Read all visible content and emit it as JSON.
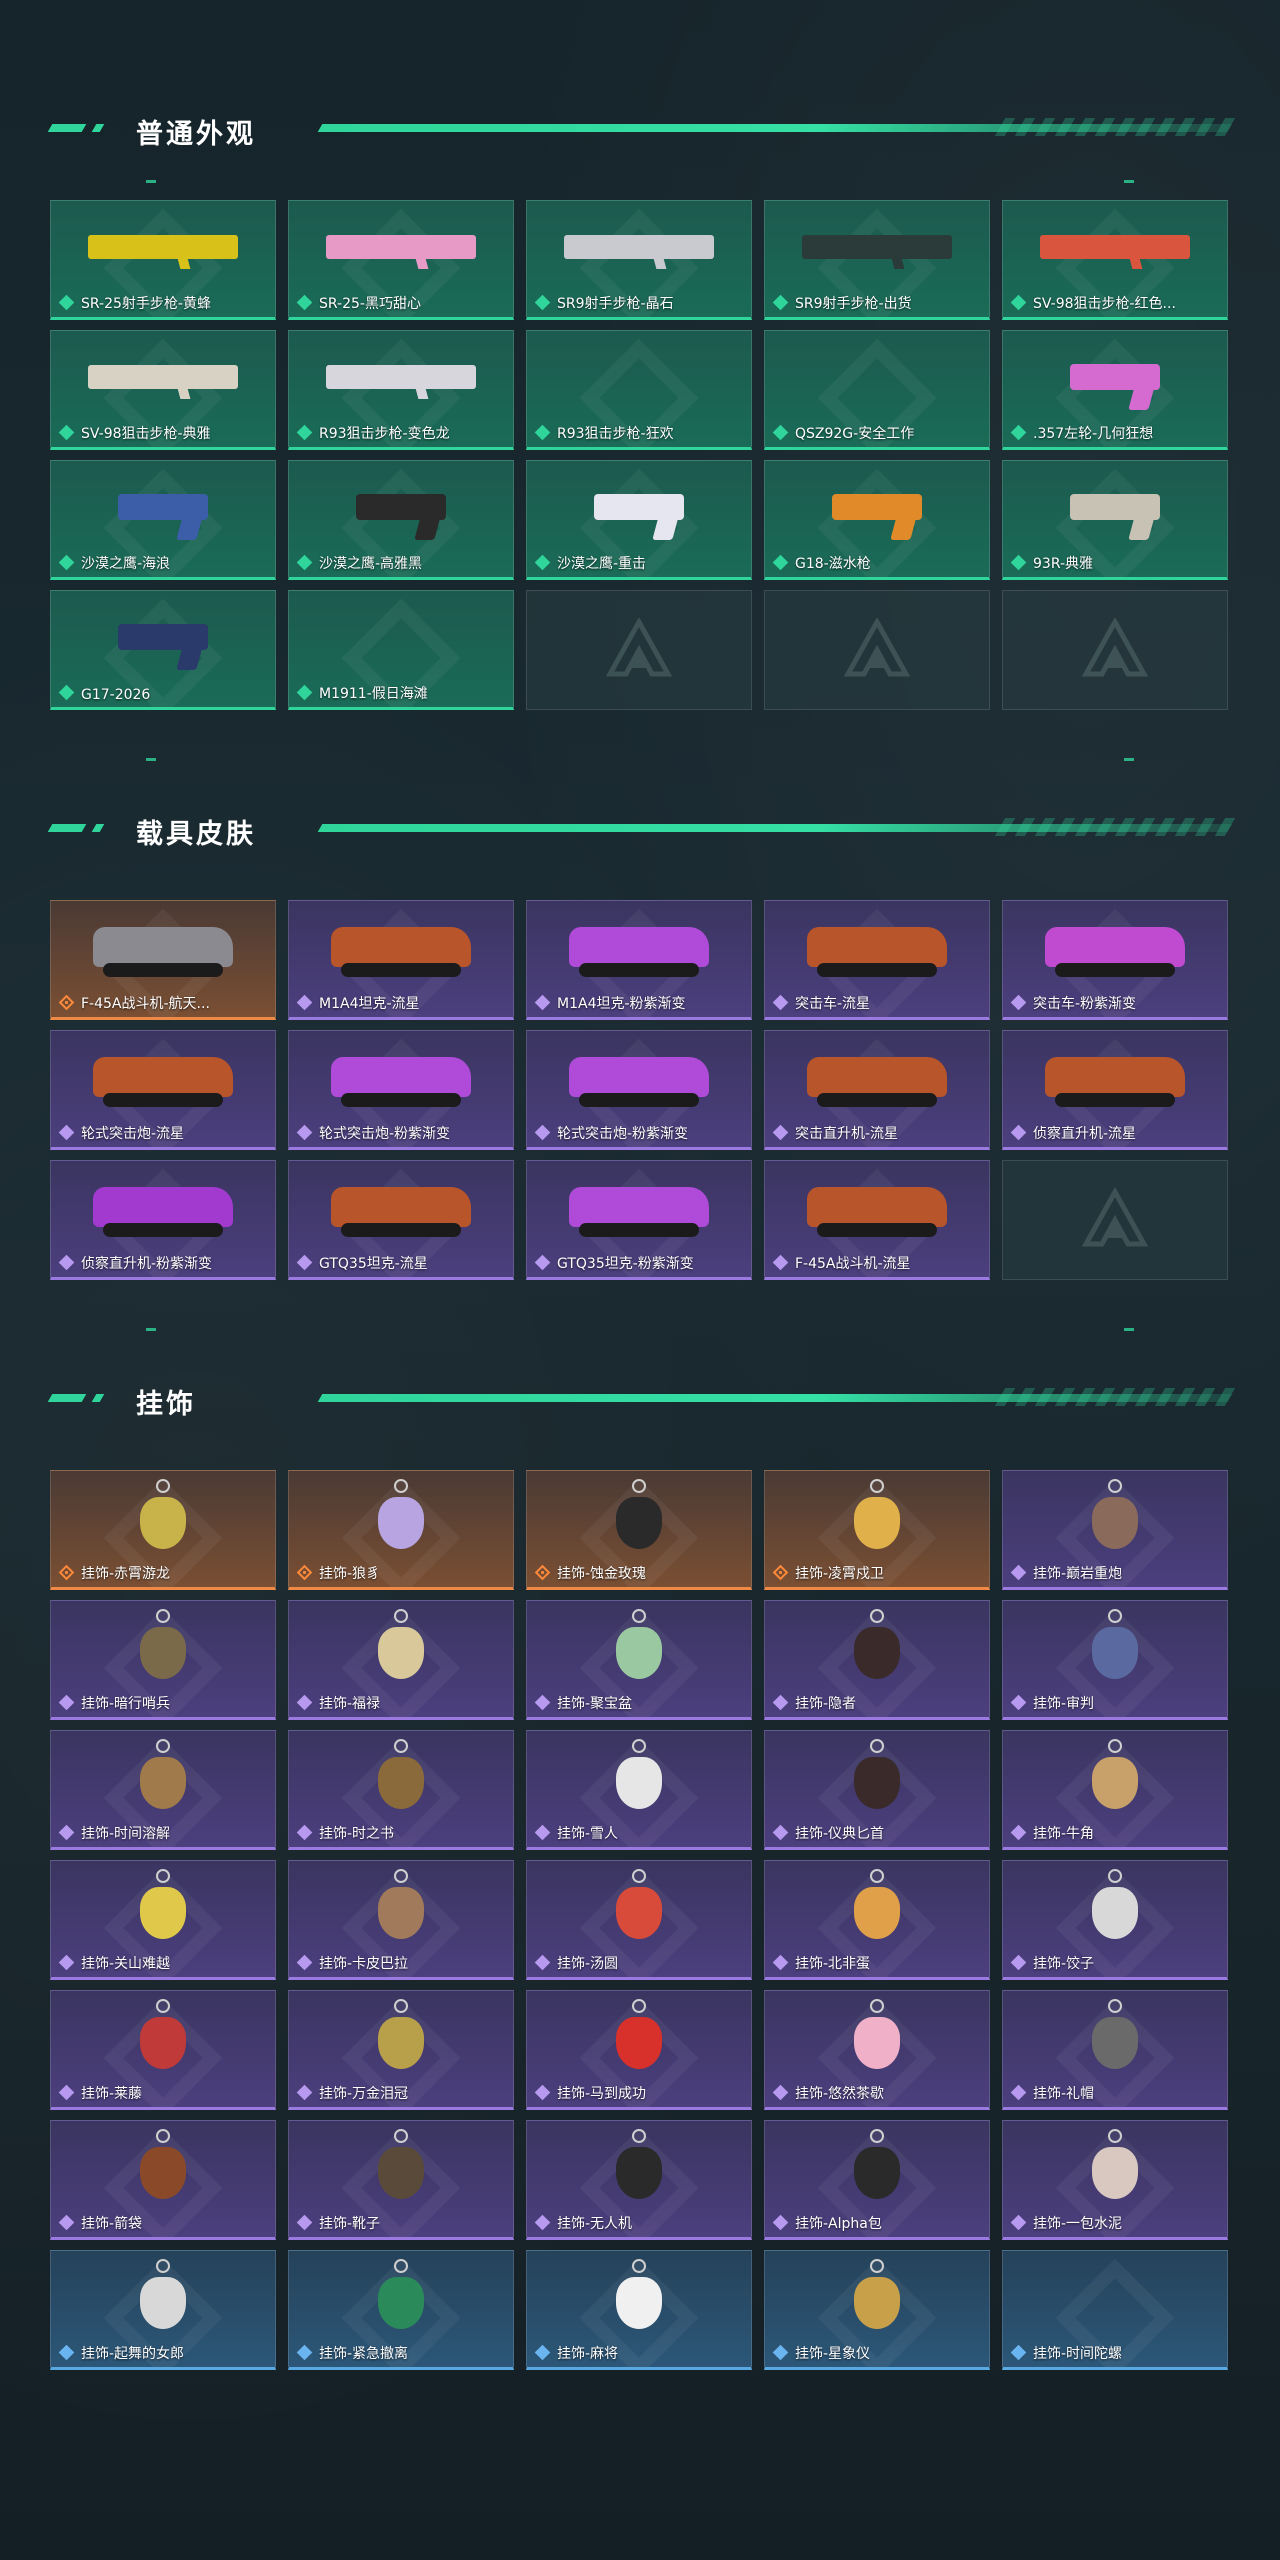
{
  "colors": {
    "accent_green": "#2fd59a",
    "rarity_green": "#1a6b57",
    "rarity_purple": "#4c3f7e",
    "rarity_orange": "#7a4f33",
    "rarity_blue": "#2c5778"
  },
  "sections": [
    {
      "title": "普通外观",
      "items": [
        {
          "label": "SR-25射手步枪-黄蜂",
          "rarity": "green",
          "icon": "rifle-icon",
          "tint": "#d8c21a"
        },
        {
          "label": "SR-25-黑巧甜心",
          "rarity": "green",
          "icon": "rifle-icon",
          "tint": "#e79ac6"
        },
        {
          "label": "SR9射手步枪-晶石",
          "rarity": "green",
          "icon": "rifle-icon",
          "tint": "#c9c9d0"
        },
        {
          "label": "SR9射手步枪-出货",
          "rarity": "green",
          "icon": "rifle-icon",
          "tint": "#2b3b3a"
        },
        {
          "label": "SV-98狙击步枪-红色...",
          "rarity": "green",
          "icon": "rifle-icon",
          "tint": "#d9553e"
        },
        {
          "label": "SV-98狙击步枪-典雅",
          "rarity": "green",
          "icon": "rifle-icon",
          "tint": "#d8d2c4"
        },
        {
          "label": "R93狙击步枪-变色龙",
          "rarity": "green",
          "icon": "rifle-icon",
          "tint": "#d6d6dc"
        },
        {
          "label": "R93狙击步枪-狂欢",
          "rarity": "green",
          "icon": "rifle-icon",
          "tint": ""
        },
        {
          "label": "QSZ92G-安全工作",
          "rarity": "green",
          "icon": "pistol-icon",
          "tint": ""
        },
        {
          "label": ".357左轮-几何狂想",
          "rarity": "green",
          "icon": "revolver-icon",
          "tint": "#d56bd0"
        },
        {
          "label": "沙漠之鹰-海浪",
          "rarity": "green",
          "icon": "pistol-icon",
          "tint": "#3c5ea8"
        },
        {
          "label": "沙漠之鹰-高雅黑",
          "rarity": "green",
          "icon": "pistol-icon",
          "tint": "#2a2a2a"
        },
        {
          "label": "沙漠之鹰-重击",
          "rarity": "green",
          "icon": "pistol-icon",
          "tint": "#e6e6f0"
        },
        {
          "label": "G18-滋水枪",
          "rarity": "green",
          "icon": "pistol-icon",
          "tint": "#e08a2a"
        },
        {
          "label": "93R-典雅",
          "rarity": "green",
          "icon": "pistol-icon",
          "tint": "#c8c2b4"
        },
        {
          "label": "G17-2026",
          "rarity": "green",
          "icon": "pistol-icon",
          "tint": "#2a3a6a"
        },
        {
          "label": "M1911-假日海滩",
          "rarity": "green",
          "icon": "pistol-icon",
          "tint": ""
        },
        {
          "label": "",
          "rarity": "empty",
          "icon": "logo-icon",
          "tint": ""
        },
        {
          "label": "",
          "rarity": "empty",
          "icon": "logo-icon",
          "tint": ""
        },
        {
          "label": "",
          "rarity": "empty",
          "icon": "logo-icon",
          "tint": ""
        }
      ]
    },
    {
      "title": "载具皮肤",
      "items": [
        {
          "label": "F-45A战斗机-航天...",
          "rarity": "orange",
          "icon": "jet-icon",
          "tint": "#8a8a90"
        },
        {
          "label": "M1A4坦克-流星",
          "rarity": "purple",
          "icon": "tank-icon",
          "tint": "#b8552a"
        },
        {
          "label": "M1A4坦克-粉紫渐变",
          "rarity": "purple",
          "icon": "tank-icon",
          "tint": "#b04ad8"
        },
        {
          "label": "突击车-流星",
          "rarity": "purple",
          "icon": "truck-icon",
          "tint": "#b8552a"
        },
        {
          "label": "突击车-粉紫渐变",
          "rarity": "purple",
          "icon": "truck-icon",
          "tint": "#c04ad0"
        },
        {
          "label": "轮式突击炮-流星",
          "rarity": "purple",
          "icon": "armored-car-icon",
          "tint": "#b8552a"
        },
        {
          "label": "轮式突击炮-粉紫渐变",
          "rarity": "purple",
          "icon": "armored-car-icon",
          "tint": "#b04ad8"
        },
        {
          "label": "轮式突击炮-粉紫渐变",
          "rarity": "purple",
          "icon": "armored-car-icon",
          "tint": "#b04ad8"
        },
        {
          "label": "突击直升机-流星",
          "rarity": "purple",
          "icon": "helicopter-icon",
          "tint": "#b8552a"
        },
        {
          "label": "侦察直升机-流星",
          "rarity": "purple",
          "icon": "helicopter-icon",
          "tint": "#b8552a"
        },
        {
          "label": "侦察直升机-粉紫渐变",
          "rarity": "purple",
          "icon": "helicopter-icon",
          "tint": "#a23ad0"
        },
        {
          "label": "GTQ35坦克-流星",
          "rarity": "purple",
          "icon": "tank-icon",
          "tint": "#b8552a"
        },
        {
          "label": "GTQ35坦克-粉紫渐变",
          "rarity": "purple",
          "icon": "tank-icon",
          "tint": "#b04ad8"
        },
        {
          "label": "F-45A战斗机-流星",
          "rarity": "purple",
          "icon": "jet-icon",
          "tint": "#b8552a"
        },
        {
          "label": "",
          "rarity": "empty",
          "icon": "logo-icon",
          "tint": ""
        }
      ]
    },
    {
      "title": "挂饰",
      "items": [
        {
          "label": "挂饰-赤霄游龙",
          "rarity": "orange",
          "icon": "charm-icon",
          "tint": "#c8b24a"
        },
        {
          "label": "挂饰-狼豸",
          "rarity": "orange",
          "icon": "charm-icon",
          "tint": "#b7a4e0"
        },
        {
          "label": "挂饰-蚀金玫瑰",
          "rarity": "orange",
          "icon": "charm-icon",
          "tint": "#2a2a2a"
        },
        {
          "label": "挂饰-凌霄戍卫",
          "rarity": "orange",
          "icon": "charm-icon",
          "tint": "#e0b04a"
        },
        {
          "label": "挂饰-巅岩重炮",
          "rarity": "purple",
          "icon": "charm-icon",
          "tint": "#8a6a5a"
        },
        {
          "label": "挂饰-暗行哨兵",
          "rarity": "purple",
          "icon": "charm-icon",
          "tint": "#7a6a4a"
        },
        {
          "label": "挂饰-福禄",
          "rarity": "purple",
          "icon": "charm-icon",
          "tint": "#d8c89a"
        },
        {
          "label": "挂饰-聚宝盆",
          "rarity": "purple",
          "icon": "charm-icon",
          "tint": "#9ac8a0"
        },
        {
          "label": "挂饰-隐者",
          "rarity": "purple",
          "icon": "charm-icon",
          "tint": "#3a2a2a"
        },
        {
          "label": "挂饰-审判",
          "rarity": "purple",
          "icon": "charm-icon",
          "tint": "#5a6aa0"
        },
        {
          "label": "挂饰-时间溶解",
          "rarity": "purple",
          "icon": "charm-icon",
          "tint": "#a07a4a"
        },
        {
          "label": "挂饰-时之书",
          "rarity": "purple",
          "icon": "charm-icon",
          "tint": "#8a6a3a"
        },
        {
          "label": "挂饰-雪人",
          "rarity": "purple",
          "icon": "charm-icon",
          "tint": "#e6e6e6"
        },
        {
          "label": "挂饰-仪典匕首",
          "rarity": "purple",
          "icon": "charm-icon",
          "tint": "#3a2a2a"
        },
        {
          "label": "挂饰-牛角",
          "rarity": "purple",
          "icon": "charm-icon",
          "tint": "#c8a06a"
        },
        {
          "label": "挂饰-关山难越",
          "rarity": "purple",
          "icon": "charm-icon",
          "tint": "#e0c84a"
        },
        {
          "label": "挂饰-卡皮巴拉",
          "rarity": "purple",
          "icon": "charm-icon",
          "tint": "#a07a5a"
        },
        {
          "label": "挂饰-汤圆",
          "rarity": "purple",
          "icon": "charm-icon",
          "tint": "#d84a3a"
        },
        {
          "label": "挂饰-北非蛋",
          "rarity": "purple",
          "icon": "charm-icon",
          "tint": "#e0a04a"
        },
        {
          "label": "挂饰-饺子",
          "rarity": "purple",
          "icon": "charm-icon",
          "tint": "#d8d8d8"
        },
        {
          "label": "挂饰-莱藤",
          "rarity": "purple",
          "icon": "charm-icon",
          "tint": "#c03a3a"
        },
        {
          "label": "挂饰-万金泪冠",
          "rarity": "purple",
          "icon": "charm-icon",
          "tint": "#b8a04a"
        },
        {
          "label": "挂饰-马到成功",
          "rarity": "purple",
          "icon": "charm-icon",
          "tint": "#d8302a"
        },
        {
          "label": "挂饰-悠然茶歇",
          "rarity": "purple",
          "icon": "charm-icon",
          "tint": "#f0b0c8"
        },
        {
          "label": "挂饰-礼帽",
          "rarity": "purple",
          "icon": "charm-icon",
          "tint": "#6a6a6a"
        },
        {
          "label": "挂饰-箭袋",
          "rarity": "purple",
          "icon": "charm-icon",
          "tint": "#8a4a2a"
        },
        {
          "label": "挂饰-靴子",
          "rarity": "purple",
          "icon": "charm-icon",
          "tint": "#5a4a3a"
        },
        {
          "label": "挂饰-无人机",
          "rarity": "purple",
          "icon": "charm-icon",
          "tint": "#2a2a2a"
        },
        {
          "label": "挂饰-Alpha包",
          "rarity": "purple",
          "icon": "charm-icon",
          "tint": "#2a2a2a"
        },
        {
          "label": "挂饰-一包水泥",
          "rarity": "purple",
          "icon": "charm-icon",
          "tint": "#d8c8c0"
        },
        {
          "label": "挂饰-起舞的女郎",
          "rarity": "blue",
          "icon": "charm-icon",
          "tint": "#d8d8d8"
        },
        {
          "label": "挂饰-紧急撤离",
          "rarity": "blue",
          "icon": "charm-icon",
          "tint": "#2a8a5a"
        },
        {
          "label": "挂饰-麻将",
          "rarity": "blue",
          "icon": "charm-icon",
          "tint": "#f0f0f0"
        },
        {
          "label": "挂饰-星象仪",
          "rarity": "blue",
          "icon": "charm-icon",
          "tint": "#c8a04a"
        },
        {
          "label": "挂饰-时间陀螺",
          "rarity": "blue",
          "icon": "charm-icon",
          "tint": ""
        }
      ]
    }
  ]
}
